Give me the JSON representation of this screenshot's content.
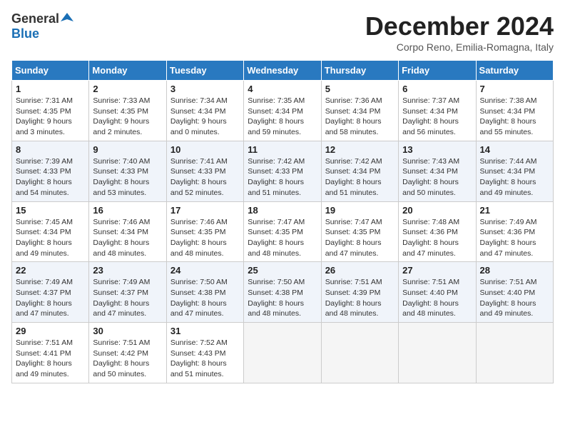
{
  "logo": {
    "general": "General",
    "blue": "Blue"
  },
  "title": "December 2024",
  "location": "Corpo Reno, Emilia-Romagna, Italy",
  "weekdays": [
    "Sunday",
    "Monday",
    "Tuesday",
    "Wednesday",
    "Thursday",
    "Friday",
    "Saturday"
  ],
  "weeks": [
    [
      {
        "day": "1",
        "sunrise": "Sunrise: 7:31 AM",
        "sunset": "Sunset: 4:35 PM",
        "daylight": "Daylight: 9 hours and 3 minutes."
      },
      {
        "day": "2",
        "sunrise": "Sunrise: 7:33 AM",
        "sunset": "Sunset: 4:35 PM",
        "daylight": "Daylight: 9 hours and 2 minutes."
      },
      {
        "day": "3",
        "sunrise": "Sunrise: 7:34 AM",
        "sunset": "Sunset: 4:34 PM",
        "daylight": "Daylight: 9 hours and 0 minutes."
      },
      {
        "day": "4",
        "sunrise": "Sunrise: 7:35 AM",
        "sunset": "Sunset: 4:34 PM",
        "daylight": "Daylight: 8 hours and 59 minutes."
      },
      {
        "day": "5",
        "sunrise": "Sunrise: 7:36 AM",
        "sunset": "Sunset: 4:34 PM",
        "daylight": "Daylight: 8 hours and 58 minutes."
      },
      {
        "day": "6",
        "sunrise": "Sunrise: 7:37 AM",
        "sunset": "Sunset: 4:34 PM",
        "daylight": "Daylight: 8 hours and 56 minutes."
      },
      {
        "day": "7",
        "sunrise": "Sunrise: 7:38 AM",
        "sunset": "Sunset: 4:34 PM",
        "daylight": "Daylight: 8 hours and 55 minutes."
      }
    ],
    [
      {
        "day": "8",
        "sunrise": "Sunrise: 7:39 AM",
        "sunset": "Sunset: 4:33 PM",
        "daylight": "Daylight: 8 hours and 54 minutes."
      },
      {
        "day": "9",
        "sunrise": "Sunrise: 7:40 AM",
        "sunset": "Sunset: 4:33 PM",
        "daylight": "Daylight: 8 hours and 53 minutes."
      },
      {
        "day": "10",
        "sunrise": "Sunrise: 7:41 AM",
        "sunset": "Sunset: 4:33 PM",
        "daylight": "Daylight: 8 hours and 52 minutes."
      },
      {
        "day": "11",
        "sunrise": "Sunrise: 7:42 AM",
        "sunset": "Sunset: 4:33 PM",
        "daylight": "Daylight: 8 hours and 51 minutes."
      },
      {
        "day": "12",
        "sunrise": "Sunrise: 7:42 AM",
        "sunset": "Sunset: 4:34 PM",
        "daylight": "Daylight: 8 hours and 51 minutes."
      },
      {
        "day": "13",
        "sunrise": "Sunrise: 7:43 AM",
        "sunset": "Sunset: 4:34 PM",
        "daylight": "Daylight: 8 hours and 50 minutes."
      },
      {
        "day": "14",
        "sunrise": "Sunrise: 7:44 AM",
        "sunset": "Sunset: 4:34 PM",
        "daylight": "Daylight: 8 hours and 49 minutes."
      }
    ],
    [
      {
        "day": "15",
        "sunrise": "Sunrise: 7:45 AM",
        "sunset": "Sunset: 4:34 PM",
        "daylight": "Daylight: 8 hours and 49 minutes."
      },
      {
        "day": "16",
        "sunrise": "Sunrise: 7:46 AM",
        "sunset": "Sunset: 4:34 PM",
        "daylight": "Daylight: 8 hours and 48 minutes."
      },
      {
        "day": "17",
        "sunrise": "Sunrise: 7:46 AM",
        "sunset": "Sunset: 4:35 PM",
        "daylight": "Daylight: 8 hours and 48 minutes."
      },
      {
        "day": "18",
        "sunrise": "Sunrise: 7:47 AM",
        "sunset": "Sunset: 4:35 PM",
        "daylight": "Daylight: 8 hours and 48 minutes."
      },
      {
        "day": "19",
        "sunrise": "Sunrise: 7:47 AM",
        "sunset": "Sunset: 4:35 PM",
        "daylight": "Daylight: 8 hours and 47 minutes."
      },
      {
        "day": "20",
        "sunrise": "Sunrise: 7:48 AM",
        "sunset": "Sunset: 4:36 PM",
        "daylight": "Daylight: 8 hours and 47 minutes."
      },
      {
        "day": "21",
        "sunrise": "Sunrise: 7:49 AM",
        "sunset": "Sunset: 4:36 PM",
        "daylight": "Daylight: 8 hours and 47 minutes."
      }
    ],
    [
      {
        "day": "22",
        "sunrise": "Sunrise: 7:49 AM",
        "sunset": "Sunset: 4:37 PM",
        "daylight": "Daylight: 8 hours and 47 minutes."
      },
      {
        "day": "23",
        "sunrise": "Sunrise: 7:49 AM",
        "sunset": "Sunset: 4:37 PM",
        "daylight": "Daylight: 8 hours and 47 minutes."
      },
      {
        "day": "24",
        "sunrise": "Sunrise: 7:50 AM",
        "sunset": "Sunset: 4:38 PM",
        "daylight": "Daylight: 8 hours and 47 minutes."
      },
      {
        "day": "25",
        "sunrise": "Sunrise: 7:50 AM",
        "sunset": "Sunset: 4:38 PM",
        "daylight": "Daylight: 8 hours and 48 minutes."
      },
      {
        "day": "26",
        "sunrise": "Sunrise: 7:51 AM",
        "sunset": "Sunset: 4:39 PM",
        "daylight": "Daylight: 8 hours and 48 minutes."
      },
      {
        "day": "27",
        "sunrise": "Sunrise: 7:51 AM",
        "sunset": "Sunset: 4:40 PM",
        "daylight": "Daylight: 8 hours and 48 minutes."
      },
      {
        "day": "28",
        "sunrise": "Sunrise: 7:51 AM",
        "sunset": "Sunset: 4:40 PM",
        "daylight": "Daylight: 8 hours and 49 minutes."
      }
    ],
    [
      {
        "day": "29",
        "sunrise": "Sunrise: 7:51 AM",
        "sunset": "Sunset: 4:41 PM",
        "daylight": "Daylight: 8 hours and 49 minutes."
      },
      {
        "day": "30",
        "sunrise": "Sunrise: 7:51 AM",
        "sunset": "Sunset: 4:42 PM",
        "daylight": "Daylight: 8 hours and 50 minutes."
      },
      {
        "day": "31",
        "sunrise": "Sunrise: 7:52 AM",
        "sunset": "Sunset: 4:43 PM",
        "daylight": "Daylight: 8 hours and 51 minutes."
      },
      null,
      null,
      null,
      null
    ]
  ]
}
